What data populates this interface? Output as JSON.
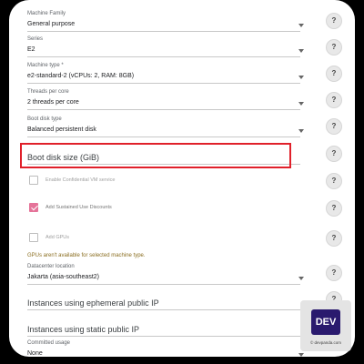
{
  "fields": {
    "machine_family": {
      "label": "Machine Family",
      "value": "General purpose"
    },
    "series": {
      "label": "Series",
      "value": "E2"
    },
    "machine_type": {
      "label": "Machine type *",
      "value": "e2-standard-2 (vCPUs: 2, RAM: 8GB)"
    },
    "threads": {
      "label": "Threads per core",
      "value": "2 threads per core"
    },
    "boot_disk_type": {
      "label": "Boot disk type",
      "value": "Balanced persistent disk"
    },
    "boot_disk_size": {
      "placeholder": "Boot disk size (GiB)"
    },
    "datacenter": {
      "label": "Datacenter location",
      "value": "Jakarta (asia-southeast2)"
    },
    "ephemeral_ip": {
      "placeholder": "Instances using ephemeral public IP"
    },
    "static_ip": {
      "placeholder": "Instances using static public IP"
    },
    "committed": {
      "label": "Committed usage",
      "value": "None"
    }
  },
  "checkboxes": {
    "confidential": {
      "label": "Enable Confidential VM service",
      "checked": false
    },
    "sud": {
      "label": "Add Sustained Use Discounts",
      "checked": true
    },
    "gpus": {
      "label": "Add GPUs",
      "checked": false
    }
  },
  "gpu_warning": "GPUs aren't available for selected machine type.",
  "help_glyph": "?",
  "highlight_color": "#e0202a",
  "accent_color": "#e57399",
  "watermark": {
    "logo": "DEV",
    "caption": "© devpanda.com"
  }
}
